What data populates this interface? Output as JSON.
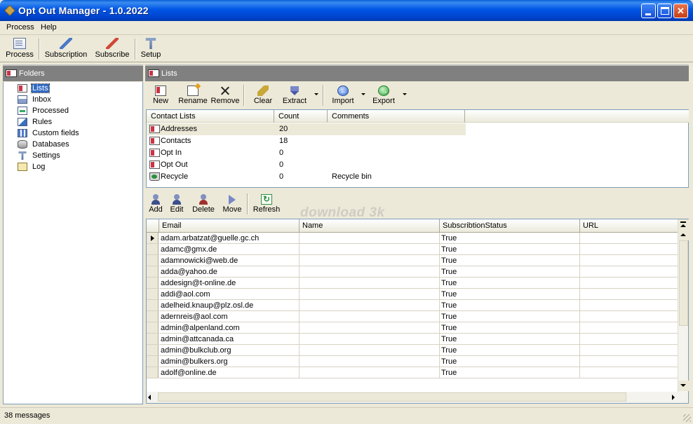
{
  "window": {
    "title": "Opt Out Manager - 1.0.2022"
  },
  "menu": [
    "Process",
    "Help"
  ],
  "toolbar": {
    "process": "Process",
    "subscription": "Subscription",
    "subscribe": "Subscribe",
    "setup": "Setup"
  },
  "folders": {
    "header": "Folders",
    "items": [
      {
        "label": "Lists",
        "icon": "contact-card-icon",
        "selected": true
      },
      {
        "label": "Inbox",
        "icon": "inbox-icon"
      },
      {
        "label": "Processed",
        "icon": "processed-icon"
      },
      {
        "label": "Rules",
        "icon": "rules-icon"
      },
      {
        "label": "Custom fields",
        "icon": "custom-fields-icon"
      },
      {
        "label": "Databases",
        "icon": "database-icon"
      },
      {
        "label": "Settings",
        "icon": "settings-icon"
      },
      {
        "label": "Log",
        "icon": "log-icon"
      }
    ]
  },
  "lists": {
    "header": "Lists",
    "toolbar": {
      "new": "New",
      "rename": "Rename",
      "remove": "Remove",
      "clear": "Clear",
      "extract": "Extract",
      "import": "Import",
      "export": "Export"
    },
    "columns": [
      "Contact Lists",
      "Count",
      "Comments"
    ],
    "rows": [
      {
        "name": "Addresses",
        "count": "20",
        "comment": ""
      },
      {
        "name": "Contacts",
        "count": "18",
        "comment": ""
      },
      {
        "name": "Opt In",
        "count": "0",
        "comment": ""
      },
      {
        "name": "Opt Out",
        "count": "0",
        "comment": ""
      },
      {
        "name": "Recycle",
        "count": "0",
        "comment": "Recycle bin"
      }
    ]
  },
  "contacts_toolbar": {
    "add": "Add",
    "edit": "Edit",
    "delete": "Delete",
    "move": "Move",
    "refresh": "Refresh"
  },
  "watermark": "download 3k",
  "grid": {
    "columns": [
      "Email",
      "Name",
      "SubscribtionStatus",
      "URL"
    ],
    "rows": [
      {
        "email": "adam.arbatzat@guelle.gc.ch",
        "name": "",
        "status": "True",
        "url": ""
      },
      {
        "email": "adamc@gmx.de",
        "name": "",
        "status": "True",
        "url": ""
      },
      {
        "email": "adamnowicki@web.de",
        "name": "",
        "status": "True",
        "url": ""
      },
      {
        "email": "adda@yahoo.de",
        "name": "",
        "status": "True",
        "url": ""
      },
      {
        "email": "addesign@t-online.de",
        "name": "",
        "status": "True",
        "url": ""
      },
      {
        "email": "addi@aol.com",
        "name": "",
        "status": "True",
        "url": ""
      },
      {
        "email": "adelheid.knaup@plz.osl.de",
        "name": "",
        "status": "True",
        "url": ""
      },
      {
        "email": "adernreis@aol.com",
        "name": "",
        "status": "True",
        "url": ""
      },
      {
        "email": "admin@alpenland.com",
        "name": "",
        "status": "True",
        "url": ""
      },
      {
        "email": "admin@attcanada.ca",
        "name": "",
        "status": "True",
        "url": ""
      },
      {
        "email": "admin@bulkclub.org",
        "name": "",
        "status": "True",
        "url": ""
      },
      {
        "email": "admin@bulkers.org",
        "name": "",
        "status": "True",
        "url": ""
      },
      {
        "email": "adolf@online.de",
        "name": "",
        "status": "True",
        "url": ""
      }
    ]
  },
  "status": {
    "text": "38 messages"
  }
}
